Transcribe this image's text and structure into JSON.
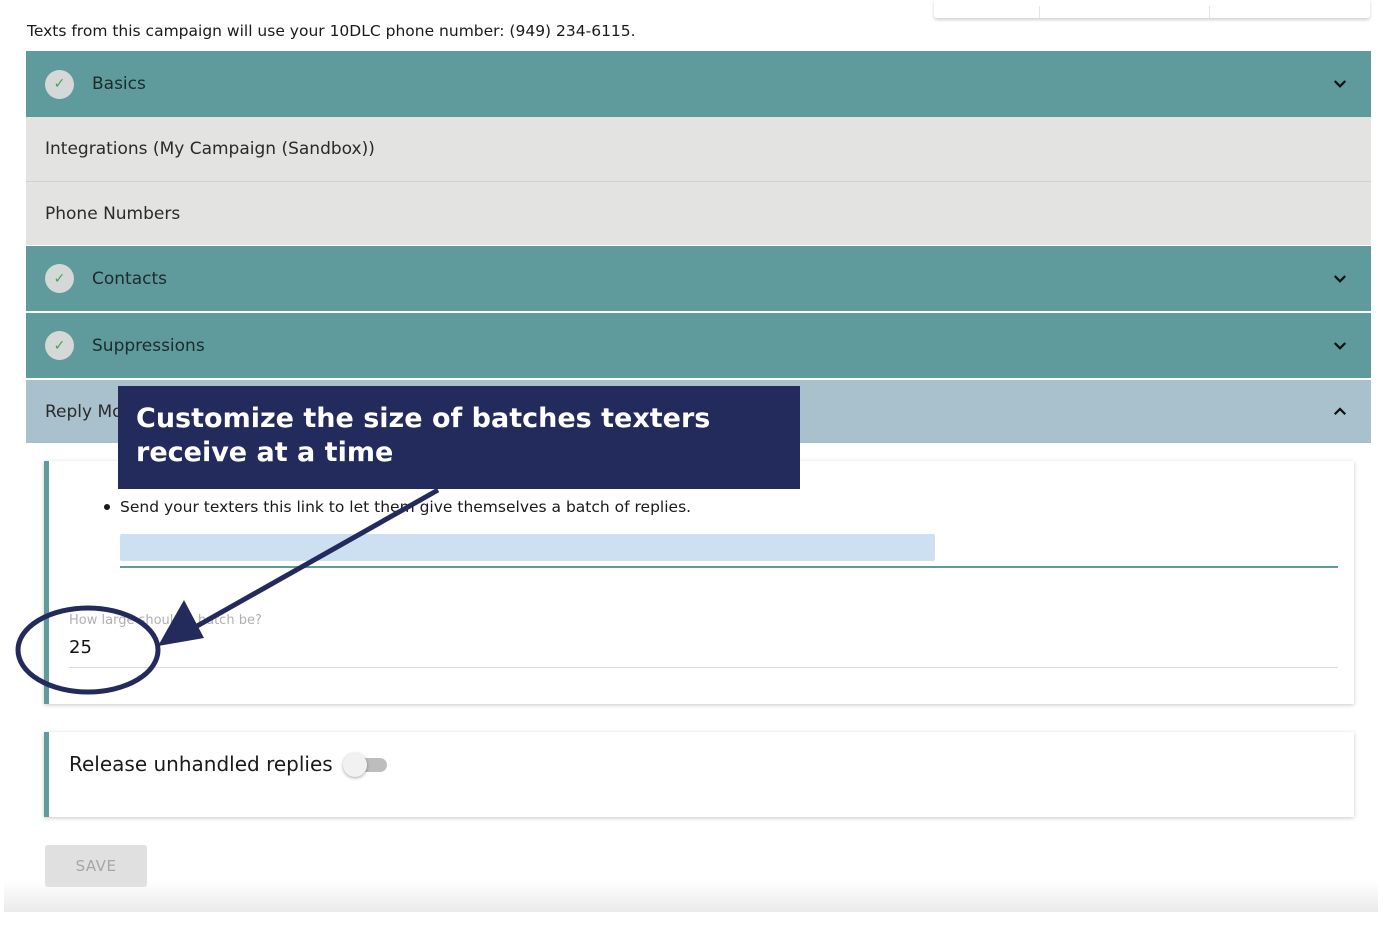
{
  "notice": "Texts from this campaign will use your 10DLC phone number: (949) 234-6115.",
  "panels": {
    "basics": "Basics",
    "integrations": "Integrations (My Campaign (Sandbox))",
    "phone_numbers": "Phone Numbers",
    "contacts": "Contacts",
    "suppressions": "Suppressions",
    "reply_mode": "Reply Mo"
  },
  "reply_section": {
    "bullet_text": "Send your texters this link to let them give themselves a batch of replies.",
    "batch_label": "How large should a batch be?",
    "batch_value": "25",
    "release_label": "Release unhandled replies",
    "release_enabled": false
  },
  "save_label": "SAVE",
  "callout": {
    "line1": "Customize the size of batches texters",
    "line2": "receive at a time"
  },
  "icons": {
    "check": "check-icon",
    "chevron_down": "chevron-down-icon",
    "chevron_up": "chevron-up-icon"
  },
  "colors": {
    "completed_panel": "#5f9a9c",
    "inactive_panel": "#e3e4e1",
    "open_panel": "#a9c0cd",
    "callout_bg": "#232a5c",
    "check_color": "#4aa34e"
  }
}
